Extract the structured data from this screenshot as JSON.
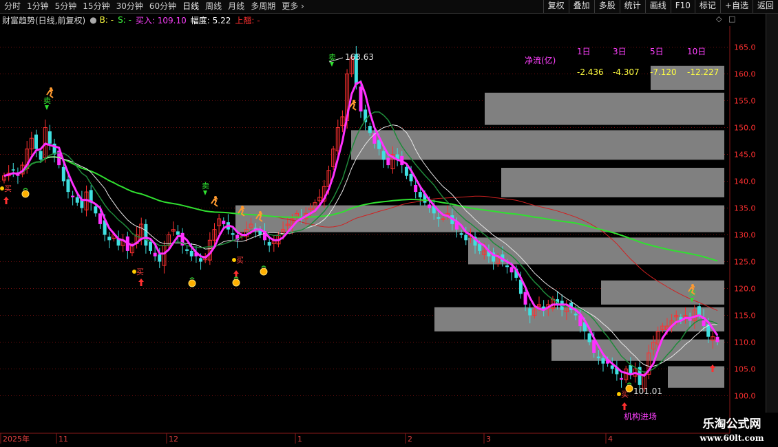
{
  "toolbar": {
    "periods": [
      "分时",
      "1分钟",
      "5分钟",
      "15分钟",
      "30分钟",
      "60分钟",
      "日线",
      "周线",
      "月线",
      "多周期",
      "更多"
    ],
    "active": "日线",
    "right_buttons": [
      "复权",
      "叠加",
      "多股",
      "统计",
      "画线",
      "F10",
      "标记",
      "+自选",
      "返回"
    ]
  },
  "indicator": {
    "name": "财富趋势(日线,前复权)",
    "b_label": "B: -",
    "s_label": "S: -",
    "buy_label": "买入: 109.10",
    "amp_label": "幅度: 5.22",
    "up_label": "上翘: -"
  },
  "netflow": {
    "title": "净流(亿)",
    "headers": [
      "1日",
      "3日",
      "5日",
      "10日"
    ],
    "values": [
      "-2.436",
      "-4.307",
      "-7.120",
      "-12.227"
    ]
  },
  "annotations": {
    "high_price": "163.63",
    "low_price": "101.01",
    "inst_label": "机构进场",
    "sell_char": "卖",
    "buy_char": "买"
  },
  "price_axis": {
    "labels": [
      "165.0",
      "160.0",
      "155.0",
      "150.0",
      "145.0",
      "140.0",
      "135.0",
      "130.0",
      "125.0",
      "120.0",
      "115.0",
      "110.0",
      "105.0",
      "100.0"
    ],
    "ylim": [
      97,
      168
    ]
  },
  "date_axis": {
    "labels": [
      "2025年",
      "11",
      "12",
      "1",
      "2",
      "3",
      "4"
    ]
  },
  "watermark": {
    "line1": "乐淘公式网",
    "line2": "www.60lt.com"
  },
  "colors": {
    "up": "#ff3030",
    "down": "#40e0e0",
    "magenta": "#ff30ff",
    "ma_green": "#30e030",
    "ma_white": "#e8e8e8",
    "ma_dkgreen": "#1f8a3a",
    "ma_red": "#d02020",
    "grid": "#7a1010",
    "box": "#808080"
  }
}
